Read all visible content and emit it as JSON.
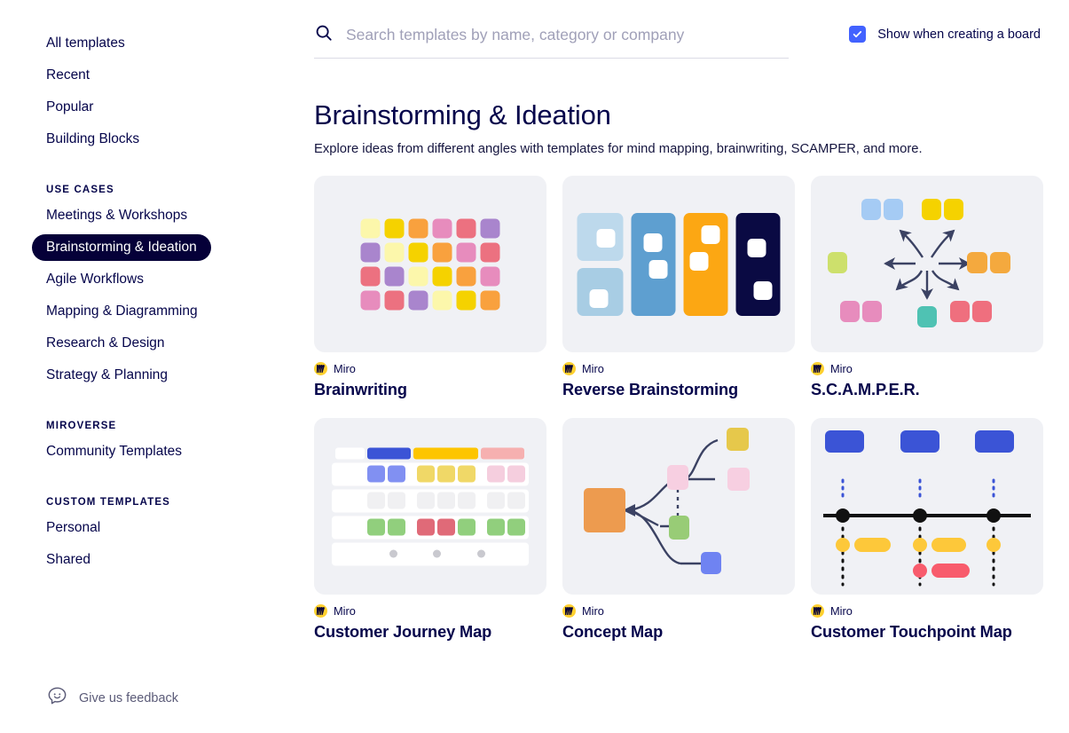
{
  "sidebar": {
    "top_items": [
      {
        "label": "All templates"
      },
      {
        "label": "Recent"
      },
      {
        "label": "Popular"
      },
      {
        "label": "Building Blocks"
      }
    ],
    "use_cases": {
      "section_label": "USE CASES",
      "items": [
        {
          "label": "Meetings & Workshops",
          "active": false
        },
        {
          "label": "Brainstorming & Ideation",
          "active": true
        },
        {
          "label": "Agile Workflows",
          "active": false
        },
        {
          "label": "Mapping & Diagramming",
          "active": false
        },
        {
          "label": "Research & Design",
          "active": false
        },
        {
          "label": "Strategy & Planning",
          "active": false
        }
      ]
    },
    "miroverse": {
      "section_label": "MIROVERSE",
      "items": [
        {
          "label": "Community Templates"
        }
      ]
    },
    "custom_templates": {
      "section_label": "CUSTOM TEMPLATES",
      "items": [
        {
          "label": "Personal"
        },
        {
          "label": "Shared"
        }
      ]
    },
    "feedback_label": "Give us feedback",
    "active_color": "#050038"
  },
  "search": {
    "placeholder": "Search templates by name, category or company",
    "value": ""
  },
  "show_when_creating": {
    "label": "Show when creating a board",
    "checked": true,
    "accent": "#4262ff"
  },
  "page": {
    "title": "Brainstorming & Ideation",
    "subtitle": "Explore ideas from different angles with templates for mind mapping, brainwriting, SCAMPER, and more."
  },
  "cards": [
    {
      "author": "Miro",
      "title": "Brainwriting"
    },
    {
      "author": "Miro",
      "title": "Reverse Brainstorming"
    },
    {
      "author": "Miro",
      "title": "S.C.A.M.P.E.R."
    },
    {
      "author": "Miro",
      "title": "Customer Journey Map"
    },
    {
      "author": "Miro",
      "title": "Concept Map"
    },
    {
      "author": "Miro",
      "title": "Customer Touchpoint Map"
    }
  ],
  "thumbnails": {
    "brainwriting": {
      "palette": {
        "pale_yellow": "#fcf7ab",
        "gold": "#f5d200",
        "orange": "#f9a13e",
        "pink": "#e78cbd",
        "red": "#ec7180",
        "purple": "#a985cd"
      },
      "rows": [
        [
          "pale_yellow",
          "gold",
          "orange",
          "pink",
          "red",
          "purple"
        ],
        [
          "purple",
          "pale_yellow",
          "gold",
          "orange",
          "pink",
          "red"
        ],
        [
          "red",
          "purple",
          "pale_yellow",
          "gold",
          "orange",
          "pink"
        ],
        [
          "pink",
          "red",
          "purple",
          "pale_yellow",
          "gold",
          "orange"
        ]
      ]
    },
    "reverse_brainstorming": {
      "columns": [
        {
          "color": "#bdd9ec",
          "split": true
        },
        {
          "color": "#5e9fd0",
          "split": false
        },
        {
          "color": "#fca713",
          "split": false
        },
        {
          "color": "#0a0a43",
          "split": false
        }
      ]
    },
    "scamper": {
      "notes": [
        {
          "color": "#a5cbf4"
        },
        {
          "color": "#a5cbf4"
        },
        {
          "color": "#f5d200"
        },
        {
          "color": "#f5d200"
        },
        {
          "color": "#cde06c"
        },
        {
          "color": "#f4a93e"
        },
        {
          "color": "#f4a93e"
        },
        {
          "color": "#e78cbd"
        },
        {
          "color": "#e78cbd"
        },
        {
          "color": "#4fc2b3"
        },
        {
          "color": "#ef6f7e"
        },
        {
          "color": "#ef6f7e"
        }
      ],
      "arrow_color": "#3b4263"
    },
    "customer_journey_map": {
      "header_colors": [
        "#ffffff",
        "#3b54d6",
        "#fdc500",
        "#f6b0b0"
      ],
      "row_colors": [
        "#8190f2",
        "#f0d867",
        "#f5cede"
      ],
      "row4_colors": [
        "#91cf7d",
        "#e06a78"
      ],
      "dot_color": "#c9c9cf"
    },
    "concept_map": {
      "nodes": [
        {
          "color": "#ed9b4f"
        },
        {
          "color": "#f7cfe1"
        },
        {
          "color": "#e6c84b"
        },
        {
          "color": "#f7cfe1"
        },
        {
          "color": "#98cc76"
        },
        {
          "color": "#6f83f2"
        }
      ],
      "line_color": "#3b4263"
    },
    "customer_touchpoint_map": {
      "top_color": "#3b54d6",
      "line_color": "#111111",
      "yellow": "#fdc83a",
      "red": "#f85b6c"
    }
  }
}
